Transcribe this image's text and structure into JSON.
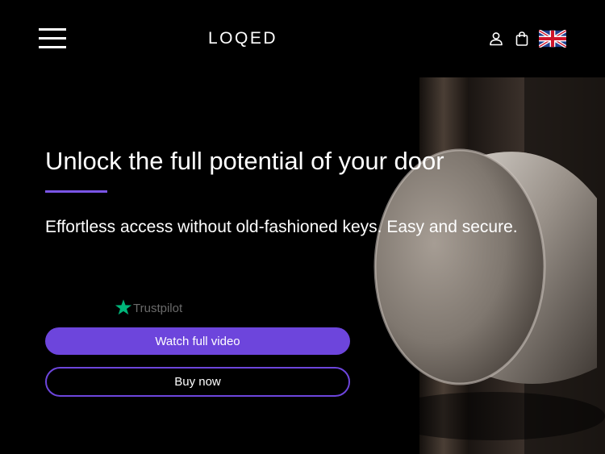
{
  "header": {
    "logo_text": "LOQED",
    "icons": {
      "menu": "hamburger-menu-icon",
      "account": "user-icon",
      "cart": "shopping-bag-icon",
      "language": "uk-flag-icon"
    }
  },
  "hero": {
    "title": "Unlock the full potential of your door",
    "subtitle": "Effortless access without old-fashioned keys. Easy and secure.",
    "trustpilot_label": "Trustpilot",
    "watch_button": "Watch full video",
    "buy_button": "Buy now"
  },
  "colors": {
    "background": "#000000",
    "accent": "#6d45dc",
    "underline": "#7a55e6",
    "trustpilot_star": "#00b67a"
  }
}
